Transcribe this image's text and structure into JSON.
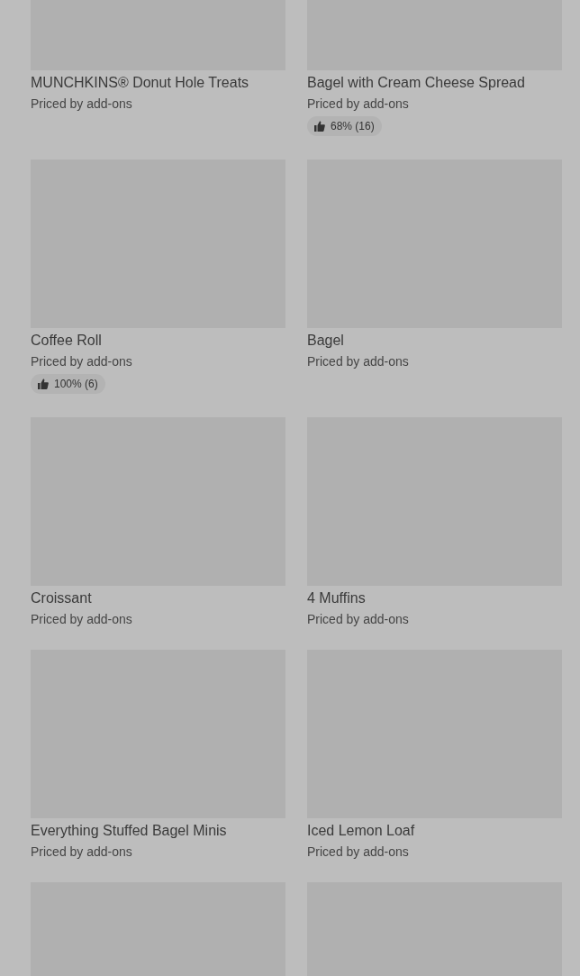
{
  "items": [
    {
      "kind": "product",
      "name": "MUNCHKINS® Donut Hole Treats",
      "price": "Priced by add-ons"
    },
    {
      "kind": "product",
      "name": "Bagel with Cream Cheese Spread",
      "price": "Priced by add-ons",
      "rating": "68% (16)"
    },
    {
      "kind": "product",
      "name": "Coffee Roll",
      "price": "Priced by add-ons",
      "rating": "100% (6)"
    },
    {
      "kind": "product",
      "name": "Bagel",
      "price": "Priced by add-ons"
    },
    {
      "kind": "product",
      "name": "Croissant",
      "price": "Priced by add-ons"
    },
    {
      "kind": "product",
      "name": "4 Muffins",
      "price": "Priced by add-ons"
    },
    {
      "kind": "product",
      "name": "Everything Stuffed Bagel Minis",
      "price": "Priced by add-ons"
    },
    {
      "kind": "product",
      "name": "Iced Lemon Loaf",
      "price": "Priced by add-ons"
    },
    {
      "kind": "image_only"
    },
    {
      "kind": "image_only"
    }
  ]
}
